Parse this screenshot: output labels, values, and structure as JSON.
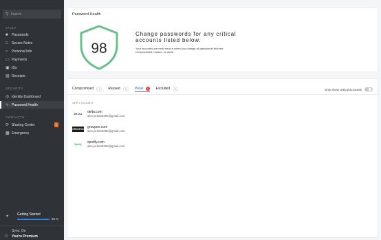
{
  "sidebar": {
    "search_placeholder": "Search",
    "vault_label": "VAULT",
    "vault_items": [
      {
        "label": "Passwords",
        "icon": "lock-icon"
      },
      {
        "label": "Secure Notes",
        "icon": "note-icon"
      },
      {
        "label": "Personal Info",
        "icon": "person-icon"
      },
      {
        "label": "Payments",
        "icon": "card-icon"
      },
      {
        "label": "IDs",
        "icon": "id-icon"
      },
      {
        "label": "Receipts",
        "icon": "receipt-icon"
      }
    ],
    "security_label": "SECURITY",
    "security_items": [
      {
        "label": "Identity Dashboard",
        "icon": "dashboard-icon"
      },
      {
        "label": "Password Health",
        "icon": "pulse-icon"
      }
    ],
    "contacts_label": "CONTACTS",
    "contacts_items": [
      {
        "label": "Sharing Center",
        "icon": "share-icon",
        "badge": "!"
      },
      {
        "label": "Emergency",
        "icon": "emergency-icon"
      }
    ],
    "getting_started": {
      "label": "Getting Started",
      "progress": 95,
      "progress_text": "95 %"
    },
    "sync": {
      "status": "Sync: On",
      "plan": "You're Premium"
    }
  },
  "header": {
    "title": "Password Health",
    "score": "98",
    "headline": "Change passwords for any critical accounts listed below.",
    "subtext": "Your accounts are most secure when you change all passwords that are compromised, reused, or weak."
  },
  "tabs": [
    {
      "label": "Compromised",
      "count": "1"
    },
    {
      "label": "Reused",
      "count": "3"
    },
    {
      "label": "Weak",
      "count": "3",
      "active": true
    },
    {
      "label": "Excluded",
      "count": "0"
    }
  ],
  "critical_toggle_label": "Only show critical accounts",
  "list": {
    "section_label": "VERY UNSAFE",
    "items": [
      {
        "logo": "DELTA",
        "site": "delta.com",
        "email": "alex.jordan0256@gmail.com"
      },
      {
        "logo": "GROUPON",
        "site": "groupon.com",
        "email": "alex.jordan0256@gmail.com"
      },
      {
        "logo": "Spotify",
        "site": "spotify.com",
        "email": "alex.jordan0256@gmail.com"
      }
    ]
  },
  "colors": {
    "sidebar_bg": "#2f3236",
    "accent_green": "#6abf8a",
    "tab_active": "#2e6fd8",
    "badge_orange": "#e8732c",
    "badge_red": "#e03a3a"
  }
}
